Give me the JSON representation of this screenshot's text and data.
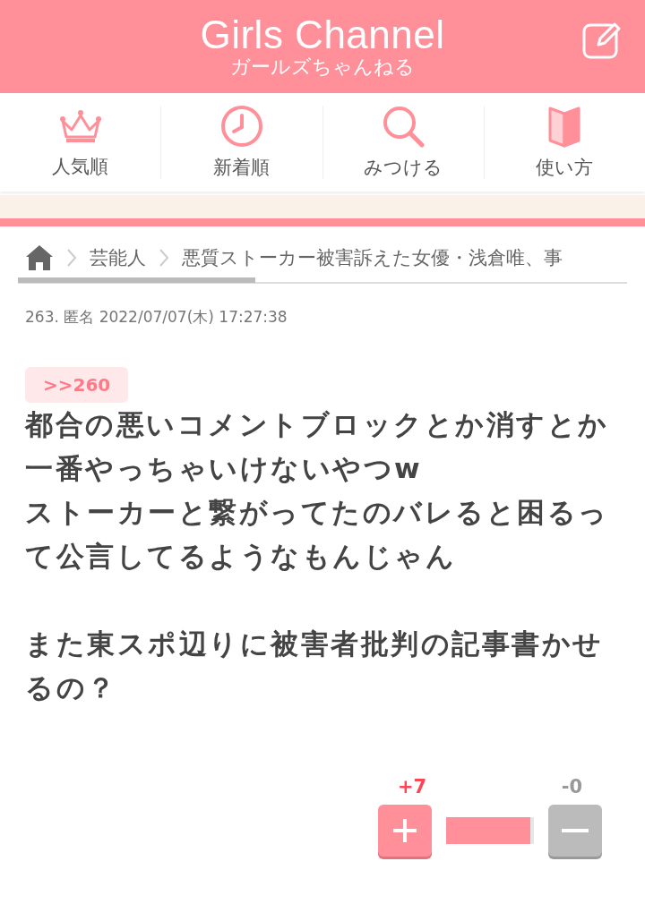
{
  "header": {
    "title": "Girls Channel",
    "subtitle": "ガールズちゃんねる"
  },
  "nav": [
    {
      "kind": "crown",
      "label": "人気順"
    },
    {
      "kind": "clock",
      "label": "新着順"
    },
    {
      "kind": "search",
      "label": "みつける"
    },
    {
      "kind": "book",
      "label": "使い方"
    }
  ],
  "breadcrumb": [
    "芸能人",
    "悪質ストーカー被害訴えた女優・浅倉唯、事"
  ],
  "comment": {
    "meta": "263. 匿名 2022/07/07(木) 17:27:38",
    "anchor": ">>260",
    "body": [
      {
        "kind": "line",
        "text": "都合の悪いコメントブロックとか消すとか一番やっちゃいけないやつw"
      },
      {
        "kind": "line",
        "text": "ストーカーと繋がってたのバレると困るって公言してるようなもんじゃん"
      },
      {
        "kind": "para",
        "text": "また東スポ辺りに被害者批判の記事書かせるの？"
      }
    ],
    "plus": "+7",
    "minus": "-0",
    "level": 1
  }
}
